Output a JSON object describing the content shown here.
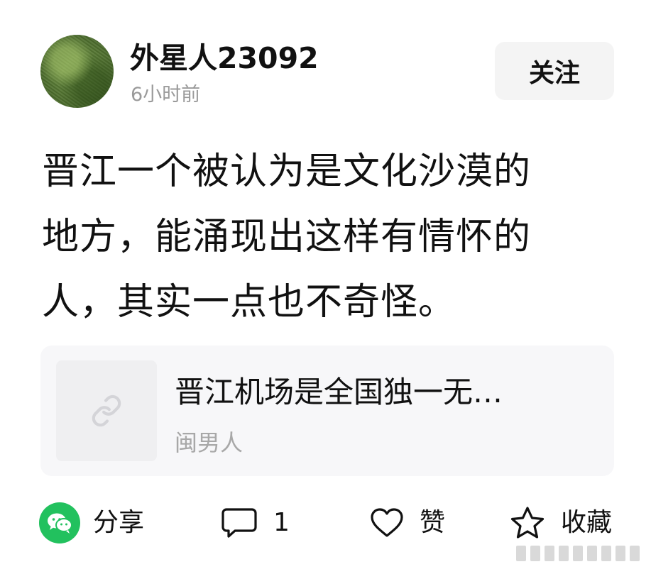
{
  "header": {
    "username": "外星人23092",
    "time": "6小时前",
    "follow_label": "关注"
  },
  "post": {
    "lines": [
      "晋江一个被认为是文化沙漠的",
      "地方，能涌现出这样有情怀的",
      "人，其实一点也不奇怪。"
    ]
  },
  "link_card": {
    "title": "晋江机场是全国独一无…",
    "source": "闽男人"
  },
  "actions": {
    "share_label": "分享",
    "comment_count": "1",
    "like_label": "赞",
    "favorite_label": "收藏"
  },
  "colors": {
    "wechat_green": "#22c15e",
    "follow_bg": "#f4f4f4",
    "card_bg": "#f7f7f9",
    "muted_text": "#9a9a9a"
  },
  "icons": {
    "share": "wechat-icon",
    "comment": "comment-bubble-icon",
    "like": "heart-icon",
    "favorite": "star-icon",
    "link": "link-icon"
  }
}
